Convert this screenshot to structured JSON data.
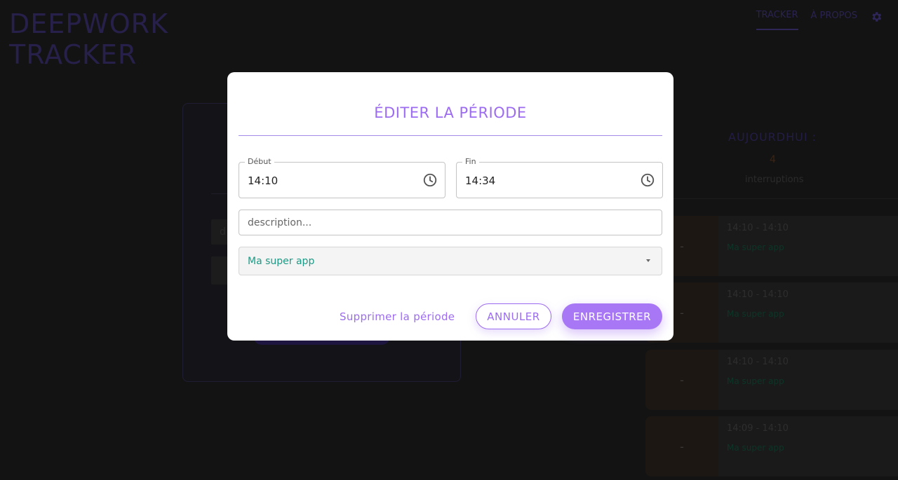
{
  "app": {
    "title_line1": "DEEPWORK",
    "title_line2": "TRACKER",
    "nav": [
      {
        "label": "TRACKER",
        "active": true
      },
      {
        "label": "À PROPOS",
        "active": false
      }
    ],
    "settings_icon": "gear-icon"
  },
  "background": {
    "input_text": "d",
    "today_label": "AUJOURDHUI :",
    "interruptions_count": "4",
    "interruptions_label": "interruptions",
    "entries": [
      {
        "duration": "-",
        "time": "14:10 - 14:10",
        "project": "Ma super app"
      },
      {
        "duration": "-",
        "time": "14:10 - 14:10",
        "project": "Ma super app"
      },
      {
        "duration": "-",
        "time": "14:10 - 14:10",
        "project": "Ma super app"
      },
      {
        "duration": "-",
        "time": "14:09 - 14:10",
        "project": "Ma super app"
      }
    ]
  },
  "dialog": {
    "title": "ÉDITER LA PÉRIODE",
    "start": {
      "label": "Début",
      "value": "14:10"
    },
    "end": {
      "label": "Fin",
      "value": "14:34"
    },
    "description": {
      "value": "",
      "placeholder": "description..."
    },
    "project": {
      "selected": "Ma super app"
    },
    "delete_label": "Supprimer la période",
    "cancel_label": "ANNULER",
    "save_label": "ENREGISTRER",
    "colors": {
      "accent": "#9c6cf0",
      "project": "#1b9a85"
    }
  }
}
